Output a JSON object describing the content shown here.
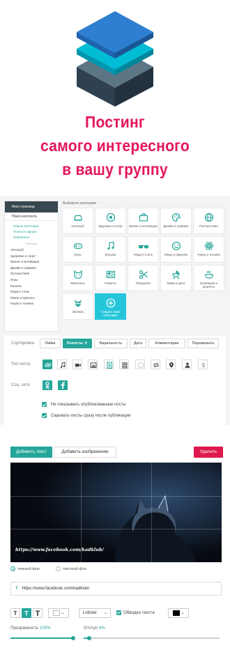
{
  "colors": {
    "accent": "#26a69a",
    "headline": "#e5175a",
    "delete": "#e0194f",
    "sidebar_head": "#37474f",
    "create_tile": "#26c6da"
  },
  "hero": {
    "headline_lines": [
      "Постинг",
      "самого интересного",
      "в вашу  группу"
    ]
  },
  "sidebar": {
    "header": "Моя страница",
    "search": "Поиск контента",
    "links": [
      "Новые категории",
      "Поиск по фразе",
      "Избранное"
    ],
    "divider": "Категории",
    "categories": [
      "Автоклуб",
      "Здоровье и спорт",
      "Бизнес и мотивация",
      "Дизайн и графика",
      "Путешествия",
      "Игры",
      "Музыка",
      "Мода и стиль",
      "Юмор и приколы",
      "Наука и техника"
    ]
  },
  "categories": {
    "title": "Выберите категорию",
    "tiles": [
      {
        "label": "Автоклуб",
        "icon": "car-icon"
      },
      {
        "label": "Здоровье и спорт",
        "icon": "ball-icon"
      },
      {
        "label": "Бизнес и мотивация",
        "icon": "briefcase-icon"
      },
      {
        "label": "Дизайн и графика",
        "icon": "palette-icon"
      },
      {
        "label": "Путешествия",
        "icon": "globe-icon"
      },
      {
        "label": "Игры",
        "icon": "gamepad-icon"
      },
      {
        "label": "Музыка",
        "icon": "music-icon"
      },
      {
        "label": "Мода и стиль",
        "icon": "glasses-icon"
      },
      {
        "label": "Юмор и приколы",
        "icon": "smile-icon"
      },
      {
        "label": "Наука и техника",
        "icon": "atom-icon"
      },
      {
        "label": "Животные",
        "icon": "cat-icon"
      },
      {
        "label": "Новости",
        "icon": "newspaper-icon"
      },
      {
        "label": "Рукоделие",
        "icon": "scissors-icon"
      },
      {
        "label": "Мамы и дети",
        "icon": "stroller-icon"
      },
      {
        "label": "Кулинария и рецепты",
        "icon": "cooking-icon"
      },
      {
        "label": "Эротика",
        "icon": "bikini-icon"
      },
      {
        "label": "Создать свою категорию",
        "icon": "plus-icon"
      }
    ]
  },
  "filters": {
    "sort_label": "Сортировка",
    "sort_options": [
      "Лайки",
      "Репосты ▼",
      "Виральность",
      "Дата",
      "Комментарии",
      "Перемешать"
    ],
    "sort_active": "Репосты ▼",
    "post_type_label": "Тип поста",
    "post_types": [
      "link-icon",
      "music-note-icon",
      "video-icon",
      "image-icon",
      "text-icon",
      "list-icon",
      "loading-icon",
      "repost-icon",
      "location-icon",
      "user-icon",
      "dollar-icon"
    ],
    "social_label": "Соц. сети",
    "social_networks": [
      "odnoklassniki-icon",
      "facebook-icon"
    ],
    "checkbox_1": "Не показывать опубликованные посты",
    "checkbox_2": "Скрывать посты сразу после публикации"
  },
  "editor": {
    "add_text": "Добавить текст",
    "add_image": "Добавить изображение",
    "delete": "Удалить",
    "canvas_caption": "https://www.facebook.com/kadklub/",
    "bg_dark": "темный фон",
    "bg_light": "светлый фон",
    "text_value": "https://www.facebook.com/kadklub/",
    "font_value": "Lobster",
    "outline_label": "Обводка текста",
    "opacity_label": "Прозрачность",
    "opacity_value": "100%",
    "opacity_fraction": 1.0,
    "padding_label": "Отступ",
    "padding_value": "4%",
    "padding_fraction": 0.04
  }
}
